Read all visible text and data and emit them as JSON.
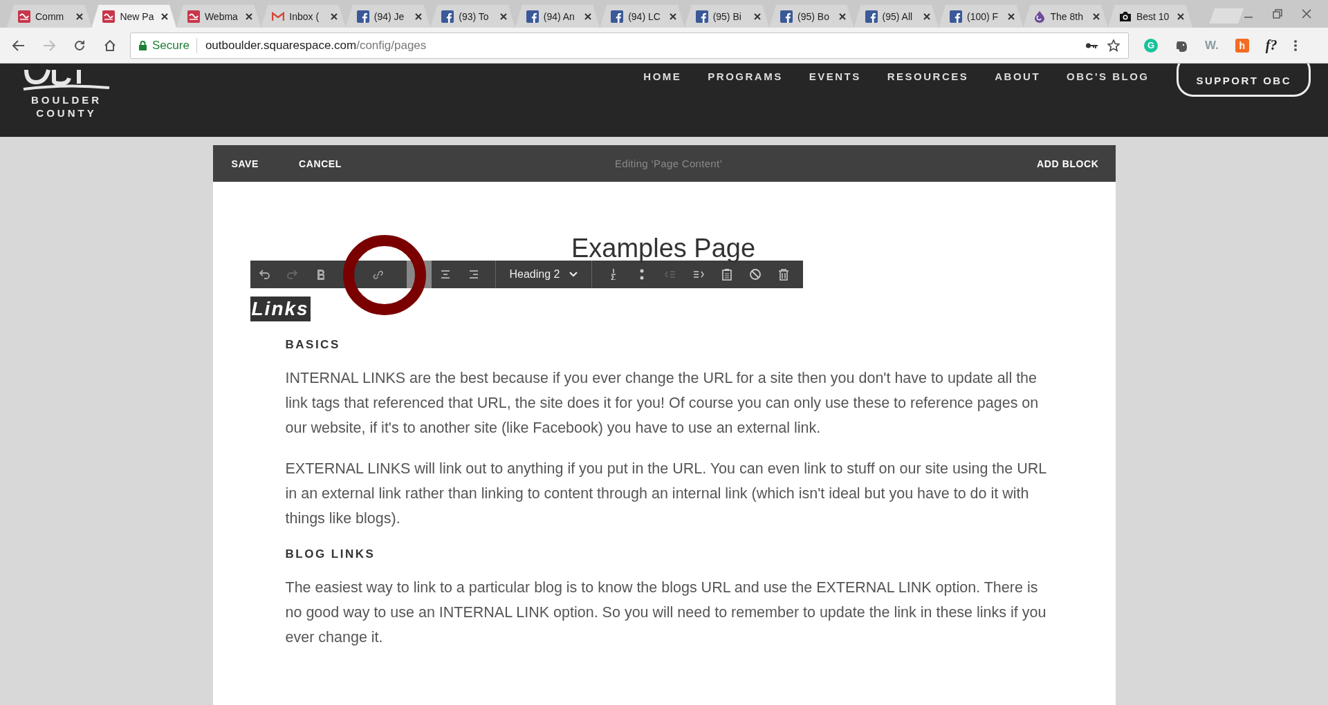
{
  "tabs": [
    {
      "title": "Comm",
      "selected": false
    },
    {
      "title": "New Pa",
      "selected": true
    },
    {
      "title": "Webma",
      "selected": false
    },
    {
      "title": "Inbox (",
      "selected": false
    },
    {
      "title": "(94) Je",
      "selected": false
    },
    {
      "title": "(93) To",
      "selected": false
    },
    {
      "title": "(94) An",
      "selected": false
    },
    {
      "title": "(94) LC",
      "selected": false
    },
    {
      "title": "(95) Bi",
      "selected": false
    },
    {
      "title": "(95) Bo",
      "selected": false
    },
    {
      "title": "(95) All",
      "selected": false
    },
    {
      "title": "(100) F",
      "selected": false
    },
    {
      "title": "The 8th",
      "selected": false
    },
    {
      "title": "Best 10",
      "selected": false
    }
  ],
  "address_bar": {
    "security": "Secure",
    "host": "outboulder.squarespace.com",
    "path": "/config/pages"
  },
  "extensions": [
    {
      "kind": "grammar",
      "label": "G"
    },
    {
      "kind": "elephant"
    },
    {
      "kind": "word",
      "label": "W."
    },
    {
      "kind": "honey",
      "label": "h"
    },
    {
      "kind": "font",
      "label": "f?"
    }
  ],
  "site_header": {
    "logo_lines": [
      "BOULDER",
      "COUNTY"
    ],
    "nav": [
      "HOME",
      "PROGRAMS",
      "EVENTS",
      "RESOURCES",
      "ABOUT",
      "OBC'S BLOG"
    ],
    "cta": "SUPPORT OBC"
  },
  "editor_bar": {
    "save": "SAVE",
    "cancel": "CANCEL",
    "status": "Editing ‘Page Content’",
    "add_block": "ADD BLOCK"
  },
  "page_title": "Examples Page",
  "format_toolbar": {
    "items": [
      {
        "kind": "button",
        "active": false,
        "disabled": false
      },
      {
        "kind": "button",
        "active": false,
        "disabled": true
      },
      {
        "kind": "button",
        "active": false,
        "disabled": false
      },
      {
        "kind": "button",
        "active": false,
        "disabled": false
      },
      {
        "kind": "button",
        "active": true,
        "disabled": false
      },
      {
        "kind": "button",
        "active": false,
        "disabled": false
      },
      {
        "kind": "button",
        "active": false,
        "disabled": false
      },
      {
        "kind": "dropdown",
        "label": "Heading 2"
      },
      {
        "kind": "button",
        "active": false,
        "disabled": false
      },
      {
        "kind": "button",
        "active": false,
        "disabled": false
      },
      {
        "kind": "button",
        "active": false,
        "disabled": true
      },
      {
        "kind": "button",
        "active": false,
        "disabled": false
      },
      {
        "kind": "button",
        "active": false,
        "disabled": false
      },
      {
        "kind": "button",
        "active": false,
        "disabled": false
      },
      {
        "kind": "button",
        "active": false,
        "disabled": false
      }
    ]
  },
  "selected_heading": "Links",
  "blocks": [
    {
      "kind": "heading",
      "text": "BASICS"
    },
    {
      "kind": "paragraph",
      "text": "INTERNAL LINKS are the best because if you ever change the URL for a site then you don't have to update all the link tags that referenced that URL, the site does it for you! Of course you can only use these to reference pages on our website, if it's to another site (like Facebook) you have to use an external link."
    },
    {
      "kind": "paragraph",
      "text": "EXTERNAL LINKS will link out to anything if you put in the URL. You can even link to stuff on our site using the URL in an external link rather than linking to content through an internal link (which isn't ideal but you have to do it with things like blogs)."
    },
    {
      "kind": "heading",
      "text": "BLOG LINKS"
    },
    {
      "kind": "paragraph",
      "text": "The easiest way to link to a particular blog is to know the blogs URL and use the EXTERNAL LINK option. There is no good way to use an INTERNAL LINK option. So you will need to remember to update the link in these links if you ever change it."
    }
  ]
}
